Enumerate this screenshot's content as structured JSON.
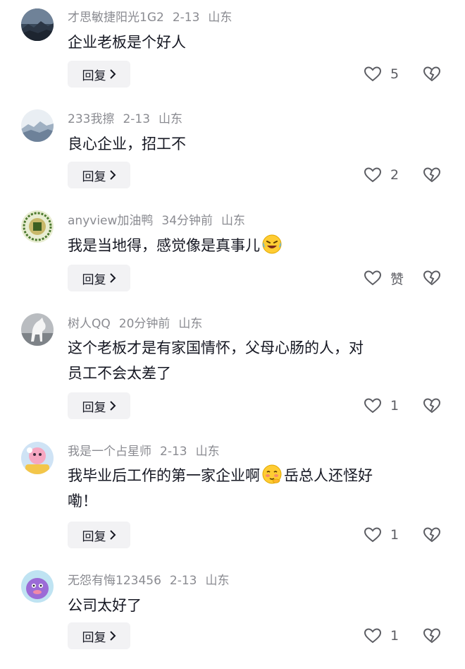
{
  "comments": [
    {
      "username": "才思敏捷阳光1G2",
      "time": "2-13",
      "location": "山东",
      "text": "企业老板是个好人",
      "reply_label": "回复",
      "likes": "5",
      "avatar": "mountain-landscape-avatar"
    },
    {
      "username": "233我擦",
      "time": "2-13",
      "location": "山东",
      "text": "良心企业，招工不",
      "reply_label": "回复",
      "likes": "2",
      "avatar": "misty-mountain-avatar"
    },
    {
      "username": "anyview加油鸭",
      "time": "34分钟前",
      "location": "山东",
      "text": "我是当地得，感觉像是真事儿",
      "emoji": "crying-laughing-emoji",
      "reply_label": "回复",
      "likes": "赞",
      "avatar": "green-badge-avatar"
    },
    {
      "username": "树人QQ",
      "time": "20分钟前",
      "location": "山东",
      "text_line1": "这个老板才是有家国情怀，父母心肠的人，对",
      "text_line2": "员工不会太差了",
      "reply_label": "回复",
      "likes": "1",
      "avatar": "white-horse-avatar"
    },
    {
      "username": "我是一个占星师",
      "time": "2-13",
      "location": "山东",
      "text_before": "我毕业后工作的第一家企业啊",
      "text_after": "岳总人还怪好",
      "text_line2": "嘞！",
      "emoji": "shy-face-emoji",
      "reply_label": "回复",
      "likes": "1",
      "avatar": "cartoon-pink-avatar"
    },
    {
      "username": "无怨有悔123456",
      "time": "2-13",
      "location": "山东",
      "text": "公司太好了",
      "reply_label": "回复",
      "likes": "1",
      "avatar": "purple-cartoon-avatar"
    }
  ],
  "colors": {
    "meta": "#8a8b91",
    "text": "#161823",
    "reply_bg": "#f2f2f4",
    "icon": "#5c5d63"
  }
}
